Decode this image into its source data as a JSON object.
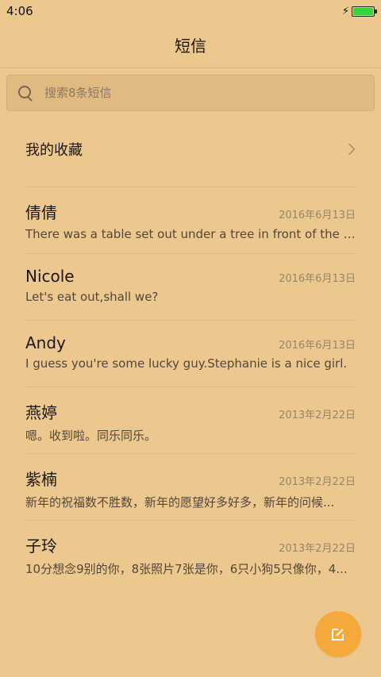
{
  "status": {
    "time": "4:06"
  },
  "header": {
    "title": "短信"
  },
  "search": {
    "placeholder": "搜索8条短信"
  },
  "favorites": {
    "label": "我的收藏"
  },
  "messages": [
    {
      "name": "倩倩",
      "date": "2016年6月13日",
      "preview": "There was a table set out under a tree in front of the ho..."
    },
    {
      "name": "Nicole",
      "date": "2016年6月13日",
      "preview": "Let's eat out,shall we?"
    },
    {
      "name": "Andy",
      "date": "2016年6月13日",
      "preview": "I guess you're some lucky guy.Stephanie is a nice girl."
    },
    {
      "name": "燕婷",
      "date": "2013年2月22日",
      "preview": "嗯。收到啦。同乐同乐。"
    },
    {
      "name": "紫楠",
      "date": "2013年2月22日",
      "preview": "新年的祝福数不胜数，新年的愿望好多好多，新年的问候..."
    },
    {
      "name": "子玲",
      "date": "2013年2月22日",
      "preview": "10分想念9别的你，8张照片7张是你，6只小狗5只像你，4..."
    }
  ],
  "colors": {
    "background": "#ecc88f",
    "fab": "#f5a93a",
    "battery": "#38d43a"
  },
  "icons": {
    "search": "search-icon",
    "chevron": "chevron-right-icon",
    "compose": "compose-icon",
    "charging": "charging-icon",
    "battery": "battery-icon"
  }
}
